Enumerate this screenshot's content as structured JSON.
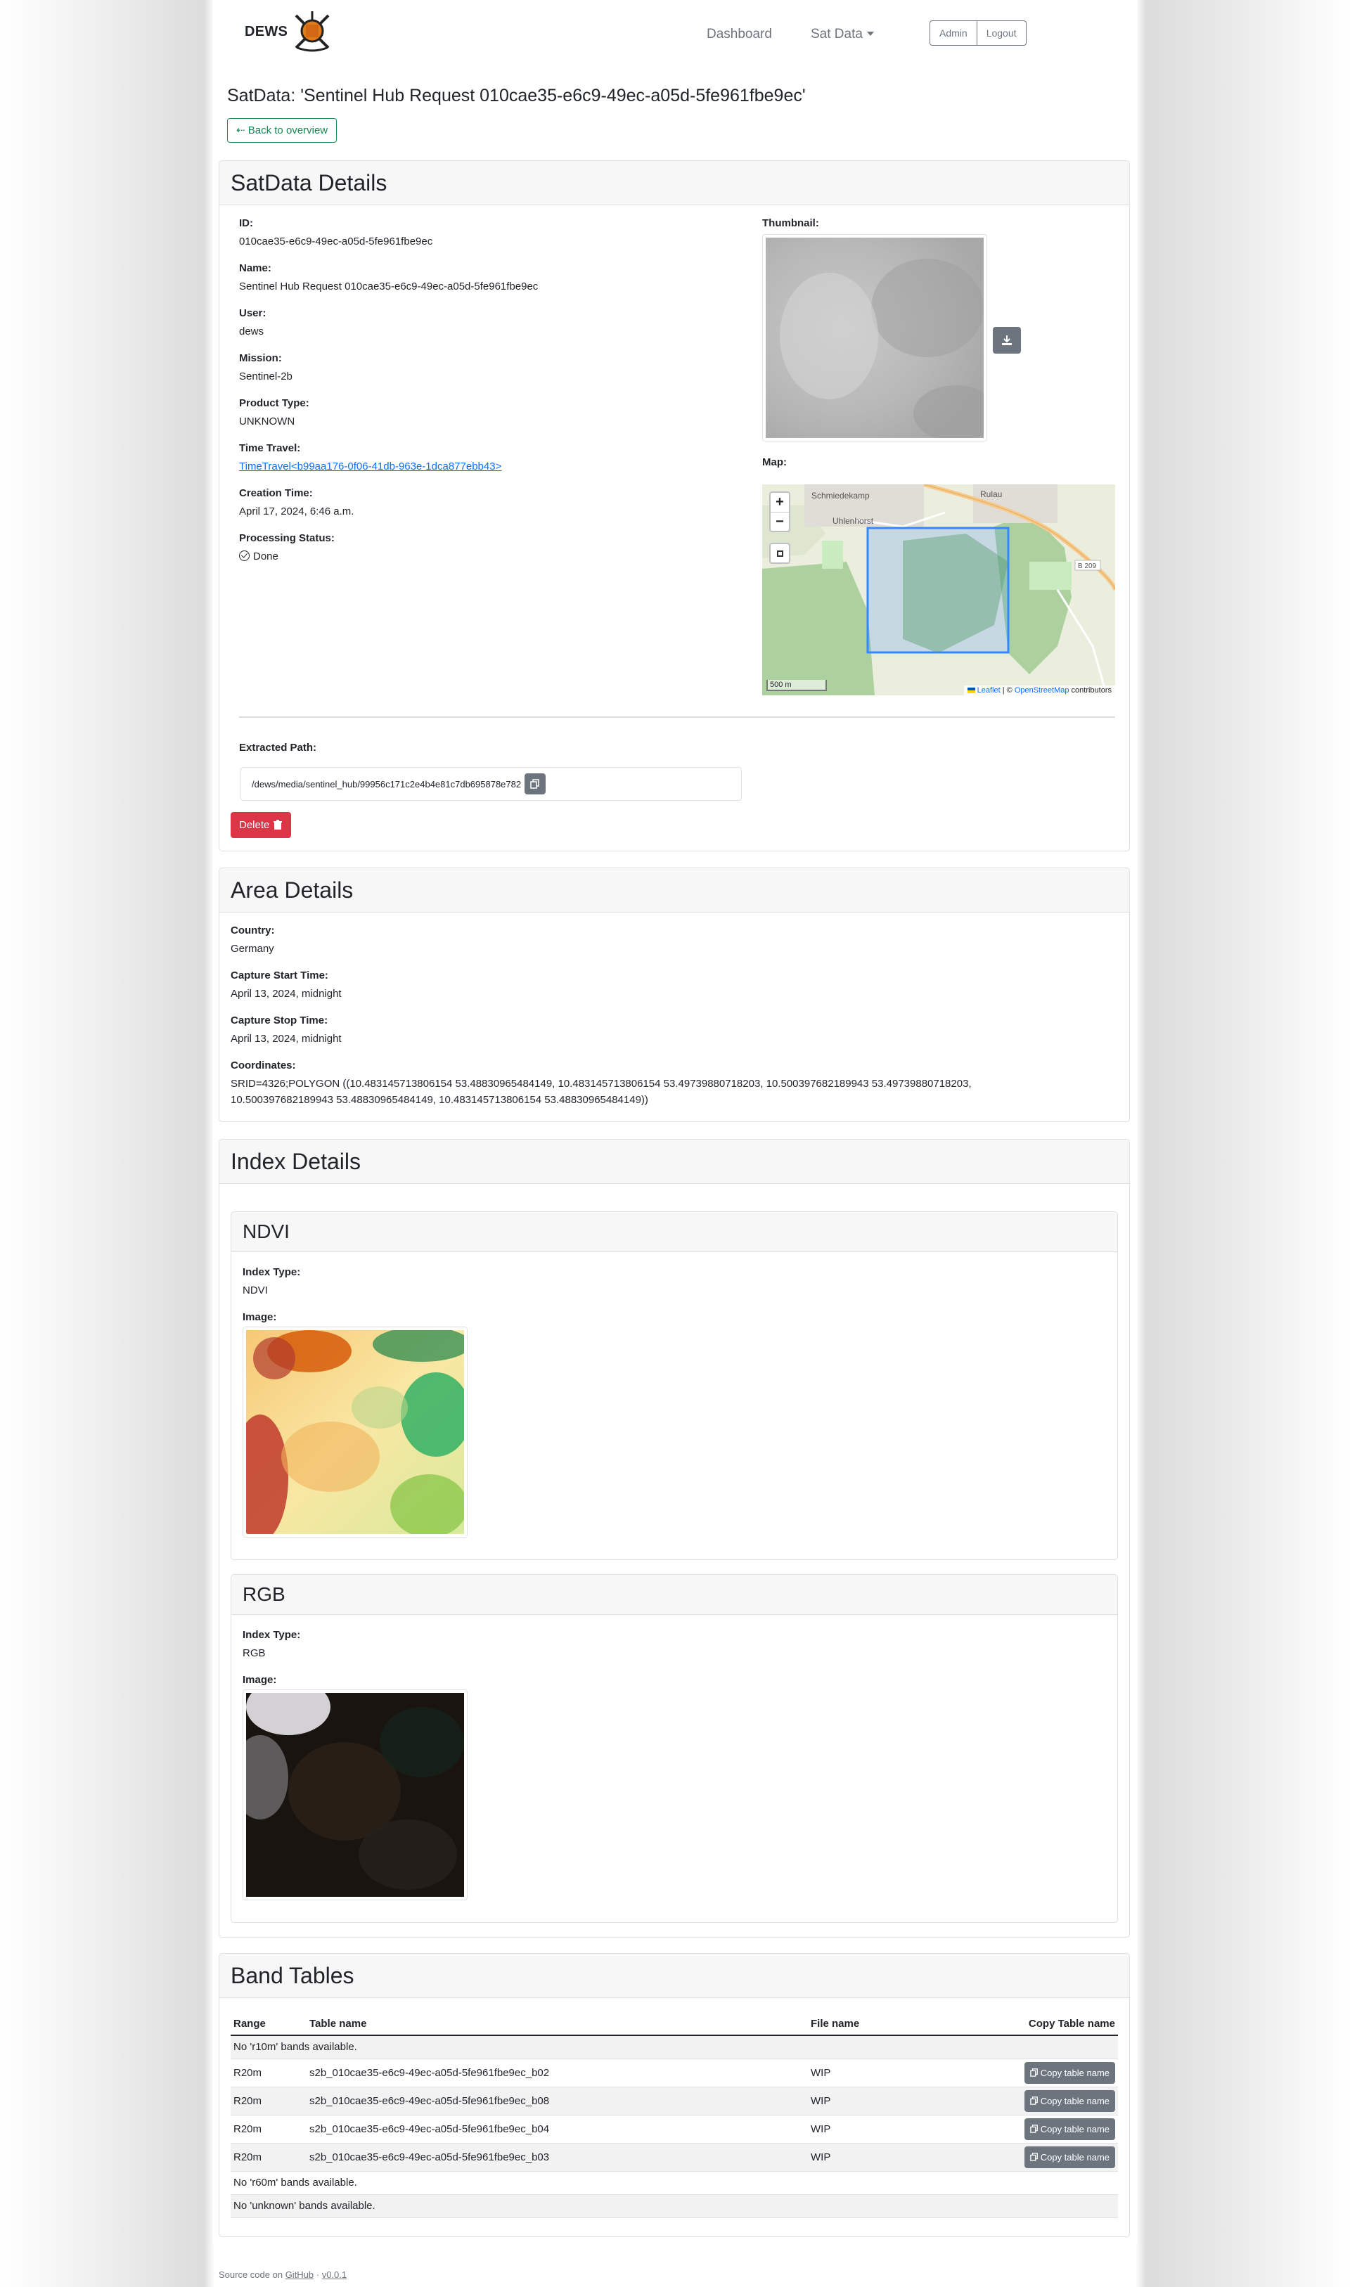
{
  "nav": {
    "brand": "DEWS",
    "dashboard": "Dashboard",
    "sat_data": "Sat Data",
    "admin": "Admin",
    "logout": "Logout"
  },
  "page": {
    "title": "SatData: 'Sentinel Hub Request 010cae35-e6c9-49ec-a05d-5fe961fbe9ec'",
    "back_label": "Back to overview"
  },
  "satdata": {
    "header": "SatData Details",
    "id_label": "ID:",
    "id": "010cae35-e6c9-49ec-a05d-5fe961fbe9ec",
    "name_label": "Name:",
    "name": "Sentinel Hub Request 010cae35-e6c9-49ec-a05d-5fe961fbe9ec",
    "user_label": "User:",
    "user": "dews",
    "mission_label": "Mission:",
    "mission": "Sentinel-2b",
    "product_type_label": "Product Type:",
    "product_type": "UNKNOWN",
    "time_travel_label": "Time Travel:",
    "time_travel": "TimeTravel<b99aa176-0f06-41db-963e-1dca877ebb43>",
    "creation_time_label": "Creation Time:",
    "creation_time": "April 17, 2024, 6:46 a.m.",
    "processing_status_label": "Processing Status:",
    "processing_status": "Done",
    "thumbnail_label": "Thumbnail:",
    "map_label": "Map:",
    "extracted_path_label": "Extracted Path:",
    "extracted_path": "/dews/media/sentinel_hub/99956c171c2e4b4e81c7db695878e782",
    "delete_label": "Delete"
  },
  "map": {
    "zoom_in": "+",
    "zoom_out": "−",
    "scale": "500 m",
    "attribution_leaflet": "Leaflet",
    "attribution_sep": " | © ",
    "attribution_osm": "OpenStreetMap",
    "attribution_tail": " contributors",
    "place1": "Schmiedekamp",
    "place2": "Uhlenhorst",
    "place3": "Rulau",
    "road": "B 209"
  },
  "area": {
    "header": "Area Details",
    "country_label": "Country:",
    "country": "Germany",
    "start_label": "Capture Start Time:",
    "start": "April 13, 2024, midnight",
    "stop_label": "Capture Stop Time:",
    "stop": "April 13, 2024, midnight",
    "coords_label": "Coordinates:",
    "coords": "SRID=4326;POLYGON ((10.483145713806154 53.48830965484149, 10.483145713806154 53.49739880718203, 10.500397682189943 53.49739880718203, 10.500397682189943 53.48830965484149, 10.483145713806154 53.48830965484149))"
  },
  "index": {
    "header": "Index Details",
    "items": [
      {
        "title": "NDVI",
        "type_label": "Index Type:",
        "type": "NDVI",
        "image_label": "Image:"
      },
      {
        "title": "RGB",
        "type_label": "Index Type:",
        "type": "RGB",
        "image_label": "Image:"
      }
    ]
  },
  "bands": {
    "header": "Band Tables",
    "columns": [
      "Range",
      "Table name",
      "File name",
      "Copy Table name"
    ],
    "copy_label": "Copy table name",
    "rows": [
      {
        "message": "No 'r10m' bands available."
      },
      {
        "range": "R20m",
        "table": "s2b_010cae35-e6c9-49ec-a05d-5fe961fbe9ec_b02",
        "file": "WIP"
      },
      {
        "range": "R20m",
        "table": "s2b_010cae35-e6c9-49ec-a05d-5fe961fbe9ec_b08",
        "file": "WIP"
      },
      {
        "range": "R20m",
        "table": "s2b_010cae35-e6c9-49ec-a05d-5fe961fbe9ec_b04",
        "file": "WIP"
      },
      {
        "range": "R20m",
        "table": "s2b_010cae35-e6c9-49ec-a05d-5fe961fbe9ec_b03",
        "file": "WIP"
      },
      {
        "message": "No 'r60m' bands available."
      },
      {
        "message": "No 'unknown' bands available."
      }
    ]
  },
  "footer": {
    "prefix": "Source code on ",
    "github": "GitHub",
    "sep": " · ",
    "version": "v0.0.1"
  },
  "colors": {
    "accent_green": "#198754",
    "danger": "#dc3545",
    "secondary": "#6c757d",
    "link": "#0d6efd"
  }
}
